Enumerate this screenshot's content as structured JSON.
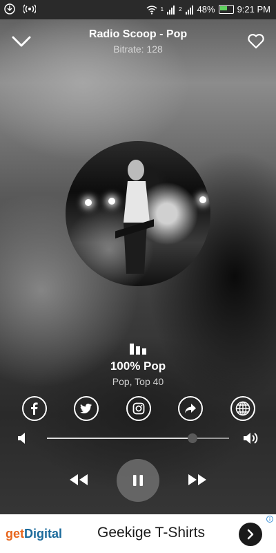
{
  "status_bar": {
    "battery_percent": "48%",
    "time": "9:21 PM",
    "sim1": "1",
    "sim2": "2"
  },
  "header": {
    "station_title": "Radio Scoop - Pop",
    "bitrate": "Bitrate: 128"
  },
  "now_playing": {
    "title": "100% Pop",
    "genre": "Pop, Top 40"
  },
  "share": {
    "items": [
      "facebook-icon",
      "twitter-icon",
      "instagram-icon",
      "share-icon",
      "globe-icon"
    ]
  },
  "volume": {
    "level": 0.8
  },
  "ad": {
    "logo_get": "get",
    "logo_digital": "Digital",
    "text": "Geekige T-Shirts"
  },
  "colors": {
    "battery_fill": "#5fd35f",
    "ad_logo_orange": "#e8661d",
    "ad_logo_blue": "#1c6b9c"
  }
}
